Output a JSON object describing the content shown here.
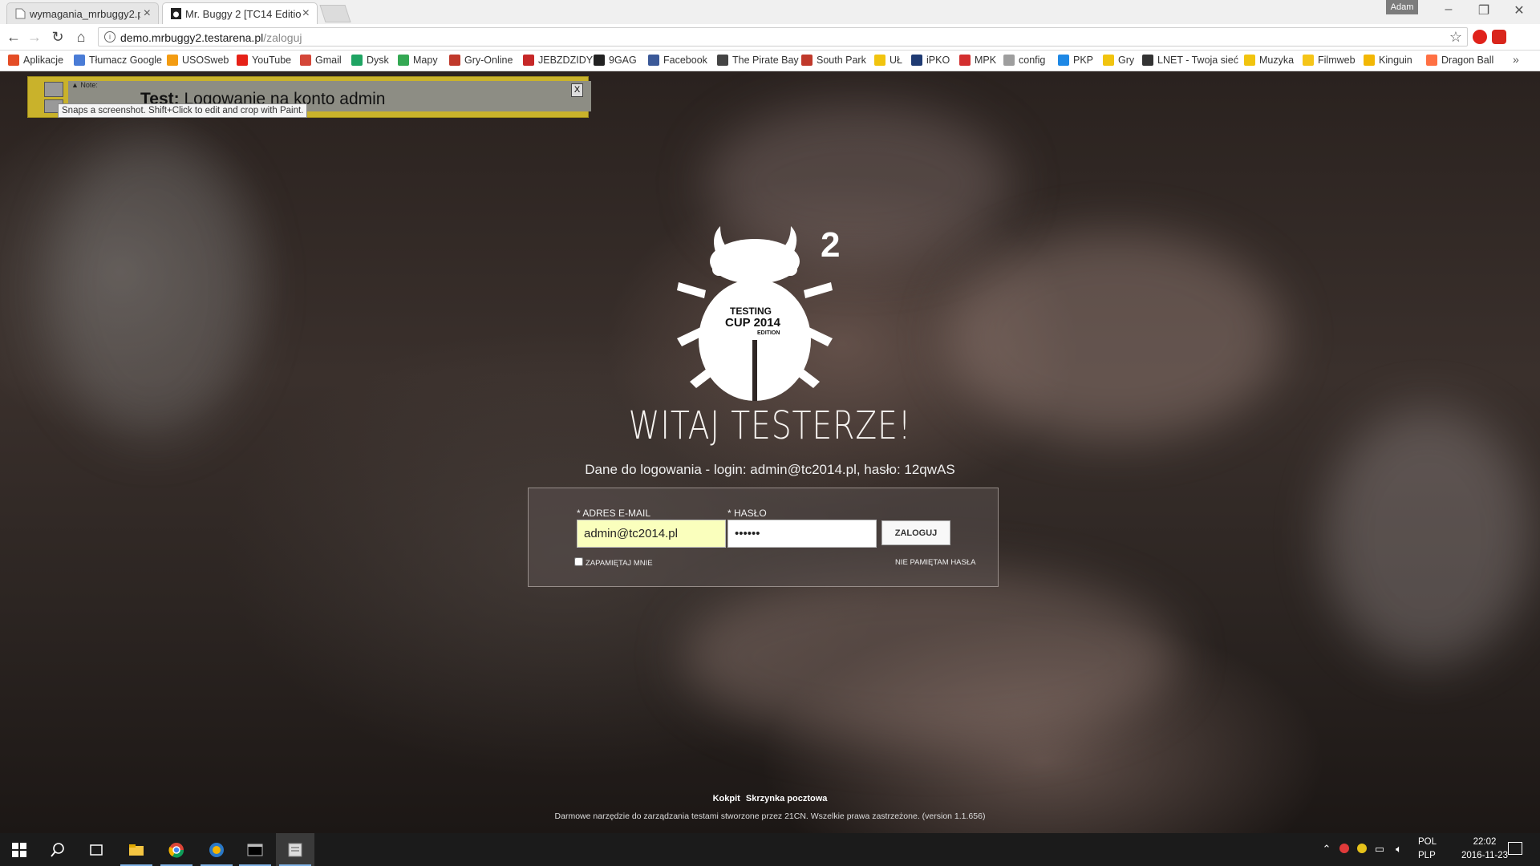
{
  "browser": {
    "tabs": [
      {
        "title": "wymagania_mrbuggy2.p",
        "active": false
      },
      {
        "title": "Mr. Buggy 2 [TC14 Editio",
        "active": true
      }
    ],
    "profile_name": "Adam",
    "url_host": "demo.mrbuggy2.testarena.pl",
    "url_path": "/zaloguj",
    "bookmarks": [
      {
        "label": "Aplikacje",
        "icon": "apps-grid-icon",
        "color": "#e44d26"
      },
      {
        "label": "Tłumacz Google",
        "icon": "google-translate-icon",
        "color": "#4a7cd6"
      },
      {
        "label": "USOSweb",
        "icon": "usosweb-icon",
        "color": "#f39c12"
      },
      {
        "label": "YouTube",
        "icon": "youtube-icon",
        "color": "#e62117"
      },
      {
        "label": "Gmail",
        "icon": "gmail-icon",
        "color": "#d44638"
      },
      {
        "label": "Dysk",
        "icon": "google-drive-icon",
        "color": "#1fa463"
      },
      {
        "label": "Mapy",
        "icon": "google-maps-icon",
        "color": "#34a853"
      },
      {
        "label": "Gry-Online",
        "icon": "gry-online-icon",
        "color": "#c0392b"
      },
      {
        "label": "JEBZDZIDY",
        "icon": "jebzdzidy-icon",
        "color": "#c62828"
      },
      {
        "label": "9GAG",
        "icon": "9gag-icon",
        "color": "#222222"
      },
      {
        "label": "Facebook",
        "icon": "facebook-icon",
        "color": "#3b5998"
      },
      {
        "label": "The Pirate Bay",
        "icon": "pirate-ship-icon",
        "color": "#444444"
      },
      {
        "label": "South Park",
        "icon": "south-park-icon",
        "color": "#c0392b"
      },
      {
        "label": "UŁ",
        "icon": "folder-icon",
        "color": "#f1c40f"
      },
      {
        "label": "iPKO",
        "icon": "ipko-icon",
        "color": "#1f3b73"
      },
      {
        "label": "MPK",
        "icon": "mpk-icon",
        "color": "#d32f2f"
      },
      {
        "label": "config",
        "icon": "document-icon",
        "color": "#9e9e9e"
      },
      {
        "label": "PKP",
        "icon": "pkp-train-icon",
        "color": "#1e88e5"
      },
      {
        "label": "Gry",
        "icon": "folder-icon",
        "color": "#f1c40f"
      },
      {
        "label": "LNET - Twoja sieć",
        "icon": "lnet-icon",
        "color": "#333333"
      },
      {
        "label": "Muzyka",
        "icon": "folder-icon",
        "color": "#f1c40f"
      },
      {
        "label": "Filmweb",
        "icon": "filmweb-icon",
        "color": "#f5c518"
      },
      {
        "label": "Kinguin",
        "icon": "kinguin-crown-icon",
        "color": "#f2b705"
      },
      {
        "label": "Dragon Ball",
        "icon": "dragon-ball-icon",
        "color": "#ff7043"
      }
    ]
  },
  "note": {
    "label": "▲ Note:",
    "test_prefix": "Test:",
    "test_text": "Logowanie na konto admin",
    "close": "X",
    "tooltip": "Snaps a screenshot. Shift+Click to edit and crop with Paint."
  },
  "page": {
    "logo_superscript": "2",
    "logo_text_1": "TESTING",
    "logo_text_2": "CUP 2014",
    "logo_text_3": "EDITION",
    "title": "WITAJ TESTERZE!",
    "subtitle": "Dane do logowania - login: admin@tc2014.pl, hasło: 12qwAS",
    "email_label": "* ADRES E-MAIL",
    "email_value": "admin@tc2014.pl",
    "password_label": "* HASŁO",
    "password_value": "••••••",
    "login_button": "ZALOGUJ",
    "remember_label": "ZAPAMIĘTAJ MNIE",
    "forgot_label": "NIE PAMIĘTAM HASŁA",
    "footer_link_1": "Kokpit",
    "footer_link_2": "Skrzynka pocztowa",
    "footer_copy": "Darmowe narzędzie do zarządzania testami stworzone przez 21CN. Wszelkie prawa zastrzeżone. (version 1.1.656)"
  },
  "taskbar": {
    "lang_1": "POL",
    "lang_2": "PLP",
    "time": "22:02",
    "date": "2016-11-23"
  },
  "colors": {
    "accent_yellow": "#c9b22b",
    "autofill": "#faffbd"
  }
}
